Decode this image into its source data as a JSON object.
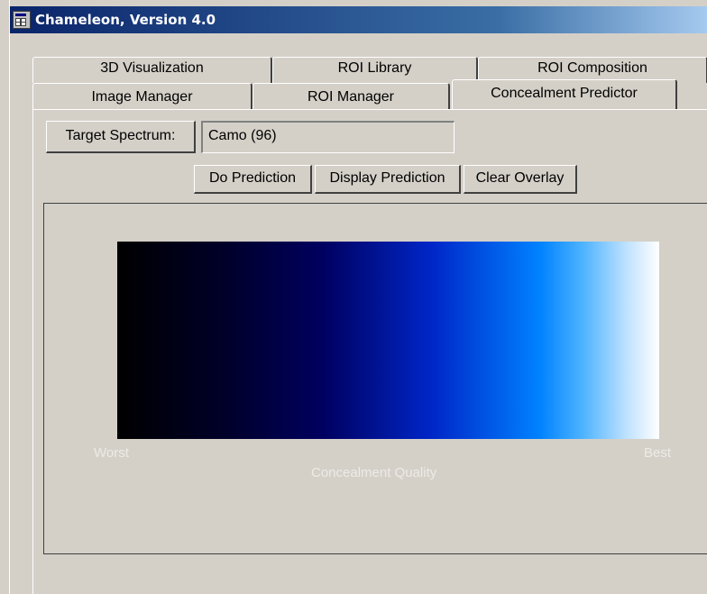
{
  "window": {
    "title": "Chameleon, Version 4.0",
    "icon": "app-window-icon"
  },
  "tabs": {
    "row_back": [
      "3D Visualization",
      "ROI Library",
      "ROI Composition"
    ],
    "row_front": [
      "Image Manager",
      "ROI Manager",
      "Concealment Predictor"
    ],
    "active": "Concealment Predictor"
  },
  "target": {
    "button_label": "Target Spectrum:",
    "value": "Camo  (96)"
  },
  "actions": {
    "do_prediction": "Do Prediction",
    "display_prediction": "Display Prediction",
    "clear_overlay": "Clear Overlay"
  },
  "scale": {
    "min_label": "Worst",
    "max_label": "Best",
    "axis_label": "Concealment Quality",
    "colors": [
      "#000000",
      "#000060",
      "#0026c8",
      "#0082ff",
      "#ffffff"
    ]
  }
}
